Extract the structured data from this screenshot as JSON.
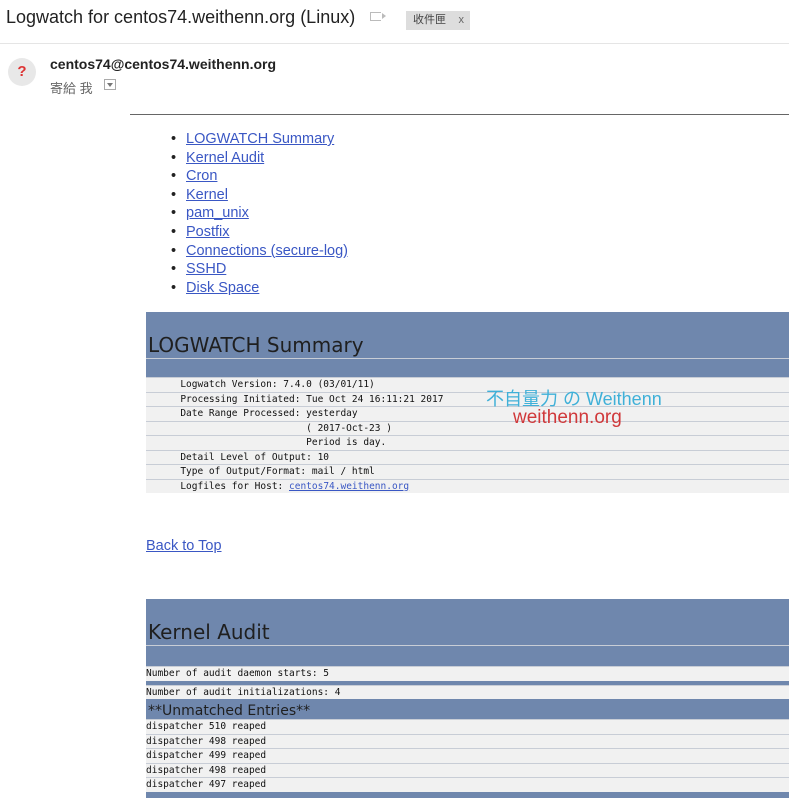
{
  "email": {
    "subject": "Logwatch for centos74.weithenn.org (Linux)",
    "label_chip": "收件匣",
    "label_chip_close": "x",
    "avatar_glyph": "?",
    "sender": "centos74@centos74.weithenn.org",
    "to_label": "寄給 我"
  },
  "toc": [
    "LOGWATCH Summary",
    "Kernel Audit",
    "Cron",
    "Kernel",
    "pam_unix",
    "Postfix",
    "Connections (secure-log)",
    "SSHD",
    "Disk Space"
  ],
  "summary": {
    "title": "LOGWATCH Summary",
    "rows": [
      "      Logwatch Version: 7.4.0 (03/01/11)",
      "      Processing Initiated: Tue Oct 24 16:11:21 2017",
      "      Date Range Processed: yesterday",
      "                            ( 2017-Oct-23 )",
      "                            Period is day.",
      "      Detail Level of Output: 10",
      "      Type of Output/Format: mail / html"
    ],
    "host_prefix": "      Logfiles for Host: ",
    "host_link": "centos74.weithenn.org"
  },
  "back_to_top": "Back to Top",
  "kernel_audit": {
    "title": "Kernel Audit",
    "stat1": "Number of audit daemon starts: 5",
    "stat2": "Number of audit initializations: 4",
    "unmatched_title": "**Unmatched Entries**",
    "entries": [
      "dispatcher 510 reaped",
      "dispatcher 498 reaped",
      "dispatcher 499 reaped",
      "dispatcher 498 reaped",
      "dispatcher 497 reaped"
    ]
  },
  "watermark": {
    "line1": "不自量力 の Weithenn",
    "line2": "weithenn.org"
  }
}
